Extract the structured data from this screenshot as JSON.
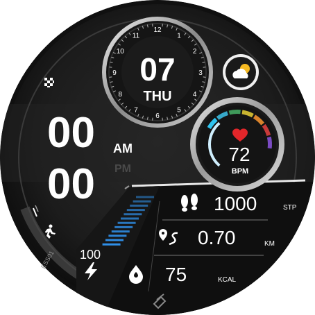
{
  "date": {
    "day": "07",
    "weekday": "THU"
  },
  "dial_numbers": [
    "12",
    "1",
    "2",
    "3",
    "4",
    "5",
    "6",
    "7",
    "8",
    "9",
    "10",
    "11"
  ],
  "time": {
    "hours": "00",
    "minutes": "00",
    "am": "AM",
    "pm": "PM",
    "active_period": "AM"
  },
  "heart": {
    "value": "72",
    "unit": "BPM"
  },
  "battery": {
    "value": "100",
    "fill_fraction": 1.0
  },
  "stats": {
    "steps": {
      "value": "1000",
      "unit": "STP"
    },
    "distance": {
      "value": "0.70",
      "unit": "KM"
    },
    "calories": {
      "value": "75",
      "unit": "KCAL"
    }
  },
  "brand": {
    "side_text": "ESS01"
  },
  "colors": {
    "accent_blue": "#2f8fe8",
    "heart_red": "#e3262a",
    "zone_colors": [
      "#2ec4f0",
      "#37a9c9",
      "#3f9a5a",
      "#c8b430",
      "#d9832c",
      "#c73a3a",
      "#7a4bc2"
    ],
    "weather_sun": "#f5b921"
  },
  "icons": [
    "flag-icon",
    "weather-icon",
    "heart-icon",
    "footprints-icon",
    "route-icon",
    "flame-icon",
    "bolt-icon",
    "runner-icon",
    "logo-icon"
  ]
}
